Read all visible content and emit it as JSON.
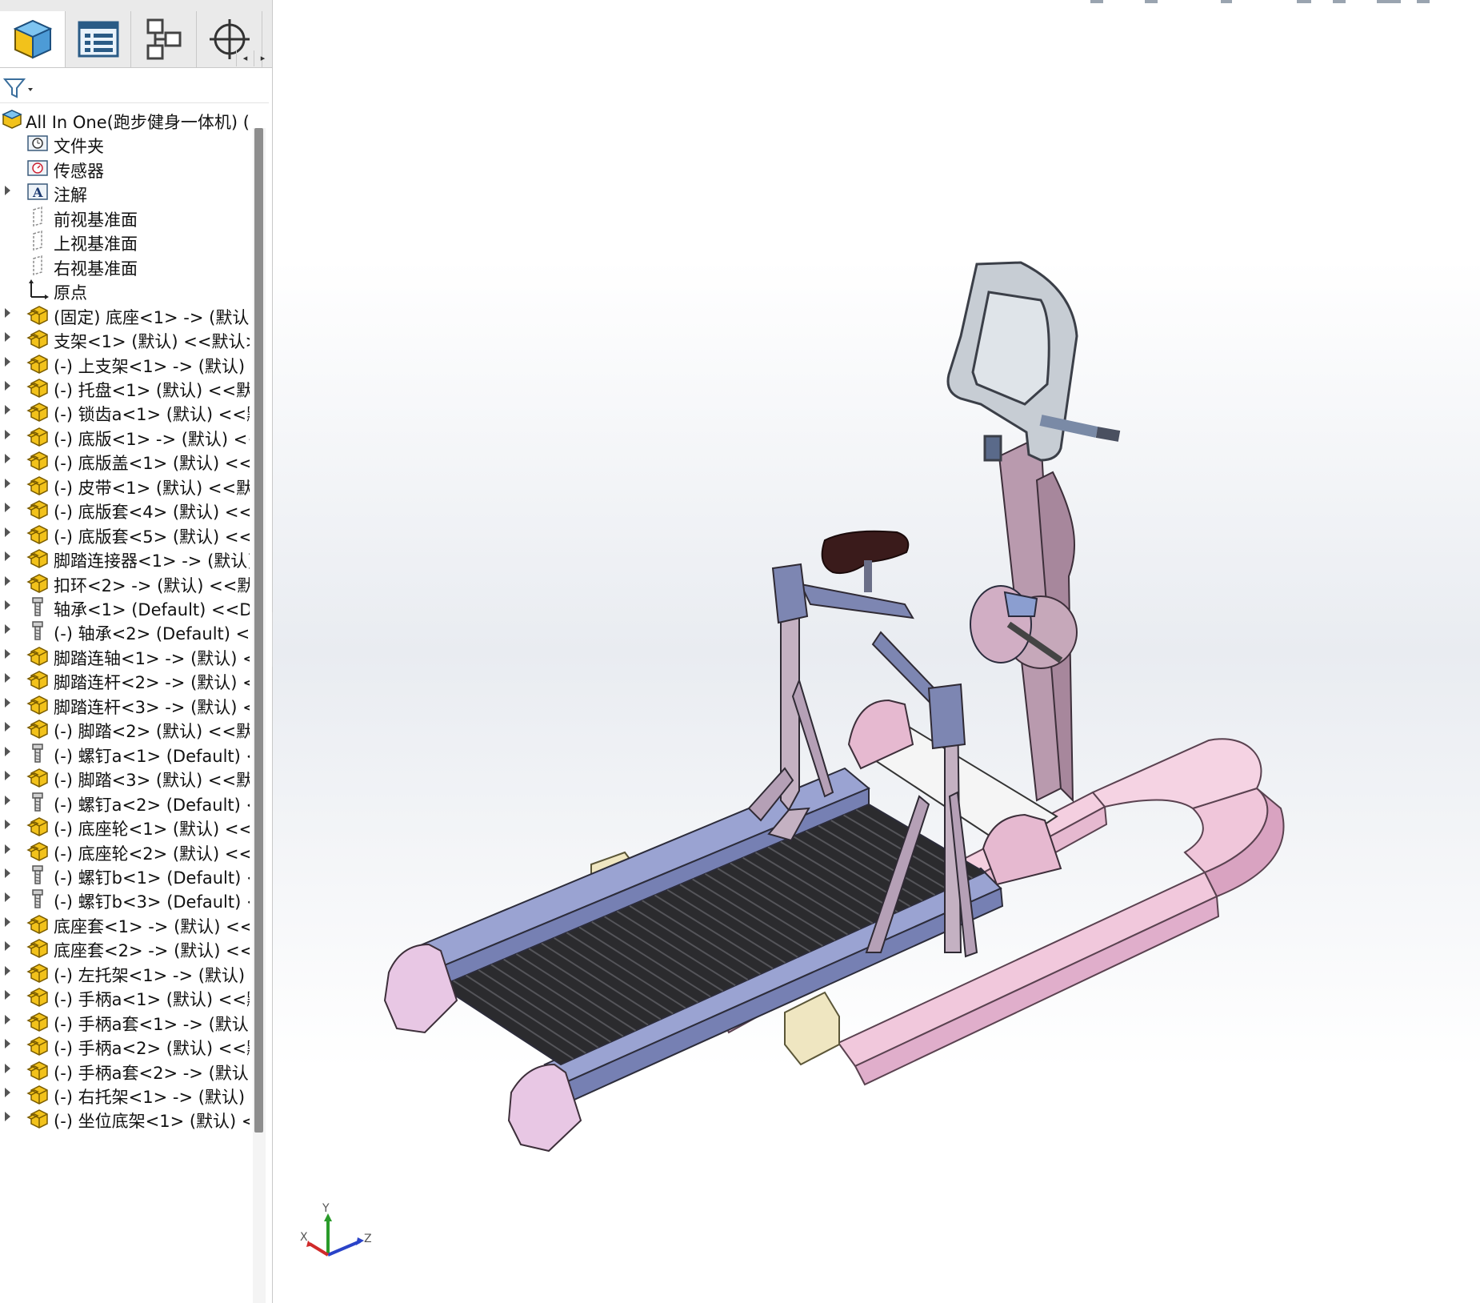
{
  "panel": {
    "tabs": [
      {
        "name": "featuremanager-tab",
        "icon": "part-cube-icon"
      },
      {
        "name": "propertymanager-tab",
        "icon": "property-list-icon"
      },
      {
        "name": "configurationmanager-tab",
        "icon": "configuration-icon"
      },
      {
        "name": "dimxpert-tab",
        "icon": "crosshair-icon"
      }
    ],
    "tab_arrows": {
      "left": "◂",
      "right": "▸"
    },
    "filter_icon": "filter-funnel-icon"
  },
  "tree": {
    "root": {
      "label": "All In One(跑步健身一体机) (",
      "icon": "assembly-icon"
    },
    "items": [
      {
        "label": "文件夹",
        "icon": "history-folder-icon",
        "arrow": false
      },
      {
        "label": "传感器",
        "icon": "sensor-icon",
        "arrow": false
      },
      {
        "label": "注解",
        "icon": "annotation-icon",
        "arrow": true
      },
      {
        "label": "前视基准面",
        "icon": "plane-icon",
        "arrow": false
      },
      {
        "label": "上视基准面",
        "icon": "plane-icon",
        "arrow": false
      },
      {
        "label": "右视基准面",
        "icon": "plane-icon",
        "arrow": false
      },
      {
        "label": "原点",
        "icon": "origin-icon",
        "arrow": false
      },
      {
        "label": "(固定) 底座<1> -> (默认)",
        "icon": "part-icon",
        "arrow": true
      },
      {
        "label": "支架<1> (默认) <<默认>",
        "icon": "part-icon",
        "arrow": true
      },
      {
        "label": "(-) 上支架<1> -> (默认) <",
        "icon": "part-icon",
        "arrow": true
      },
      {
        "label": "(-) 托盘<1> (默认) <<默认",
        "icon": "part-icon",
        "arrow": true
      },
      {
        "label": "(-) 锁齿a<1> (默认) <<默",
        "icon": "part-icon",
        "arrow": true
      },
      {
        "label": "(-) 底版<1> -> (默认) <<",
        "icon": "part-icon",
        "arrow": true
      },
      {
        "label": "(-) 底版盖<1> (默认) <<默",
        "icon": "part-icon",
        "arrow": true
      },
      {
        "label": "(-) 皮带<1> (默认) <<默认",
        "icon": "part-icon",
        "arrow": true
      },
      {
        "label": "(-) 底版套<4> (默认) <<默",
        "icon": "part-icon",
        "arrow": true
      },
      {
        "label": "(-) 底版套<5> (默认) <<默",
        "icon": "part-icon",
        "arrow": true
      },
      {
        "label": "脚踏连接器<1> -> (默认)",
        "icon": "part-icon",
        "arrow": true
      },
      {
        "label": "扣环<2> -> (默认) <<默认",
        "icon": "part-icon",
        "arrow": true
      },
      {
        "label": "轴承<1> (Default) <<De",
        "icon": "toolbox-icon",
        "arrow": true
      },
      {
        "label": "(-) 轴承<2> (Default) <<",
        "icon": "toolbox-icon",
        "arrow": true
      },
      {
        "label": "脚踏连轴<1> -> (默认) <",
        "icon": "part-icon",
        "arrow": true
      },
      {
        "label": "脚踏连杆<2> -> (默认) <",
        "icon": "part-icon",
        "arrow": true
      },
      {
        "label": "脚踏连杆<3> -> (默认) <",
        "icon": "part-icon",
        "arrow": true
      },
      {
        "label": "(-) 脚踏<2> (默认) <<默认",
        "icon": "part-icon",
        "arrow": true
      },
      {
        "label": "(-) 螺钉a<1> (Default) <",
        "icon": "toolbox-icon",
        "arrow": true
      },
      {
        "label": "(-) 脚踏<3> (默认) <<默认",
        "icon": "part-icon",
        "arrow": true
      },
      {
        "label": "(-) 螺钉a<2> (Default) <",
        "icon": "toolbox-icon",
        "arrow": true
      },
      {
        "label": "(-) 底座轮<1> (默认) <<默",
        "icon": "part-icon",
        "arrow": true
      },
      {
        "label": "(-) 底座轮<2> (默认) <<默",
        "icon": "part-icon",
        "arrow": true
      },
      {
        "label": "(-) 螺钉b<1> (Default) <",
        "icon": "toolbox-icon",
        "arrow": true
      },
      {
        "label": "(-) 螺钉b<3> (Default) <",
        "icon": "toolbox-icon",
        "arrow": true
      },
      {
        "label": "底座套<1> -> (默认) <<默",
        "icon": "part-icon",
        "arrow": true
      },
      {
        "label": "底座套<2> -> (默认) <<默",
        "icon": "part-icon",
        "arrow": true
      },
      {
        "label": "(-) 左托架<1> -> (默认) <",
        "icon": "part-icon",
        "arrow": true
      },
      {
        "label": "(-) 手柄a<1> (默认) <<默",
        "icon": "part-icon",
        "arrow": true
      },
      {
        "label": "(-) 手柄a套<1> -> (默认)",
        "icon": "part-icon",
        "arrow": true
      },
      {
        "label": "(-) 手柄a<2> (默认) <<默",
        "icon": "part-icon",
        "arrow": true
      },
      {
        "label": "(-) 手柄a套<2> -> (默认)",
        "icon": "part-icon",
        "arrow": true
      },
      {
        "label": "(-) 右托架<1> -> (默认) <",
        "icon": "part-icon",
        "arrow": true
      },
      {
        "label": "(-) 坐位底架<1> (默认) <",
        "icon": "part-icon",
        "arrow": true
      }
    ]
  },
  "triad": {
    "x": "X",
    "y": "Y",
    "z": "Z"
  },
  "colors": {
    "frame_pink": "#e6b9d0",
    "rail_blue": "#8e98c8",
    "belt_black": "#2b2b2e",
    "column_mauve": "#b99aae",
    "console_gray": "#c7cdd4",
    "seat_brown": "#3a1b1b",
    "end_cap_cream": "#efe6c1"
  }
}
